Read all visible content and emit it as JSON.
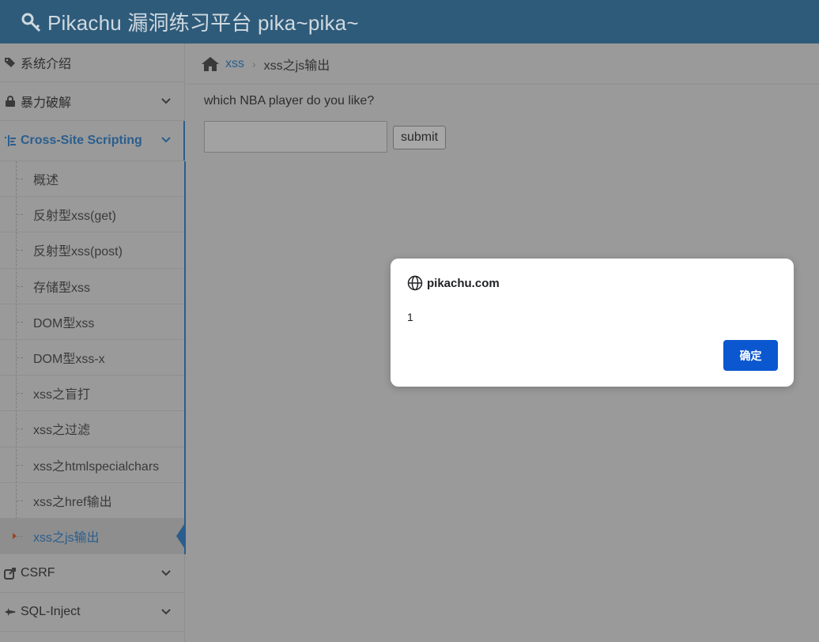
{
  "header": {
    "brand": "Pikachu 漏洞练习平台 pika~pika~"
  },
  "sidebar": {
    "top_items": [
      {
        "label": "系统介绍"
      },
      {
        "label": "暴力破解"
      },
      {
        "label": "Cross-Site Scripting"
      }
    ],
    "xss_submenu": [
      "概述",
      "反射型xss(get)",
      "反射型xss(post)",
      "存储型xss",
      "DOM型xss",
      "DOM型xss-x",
      "xss之盲打",
      "xss之过滤",
      "xss之htmlspecialchars",
      "xss之href输出",
      "xss之js输出"
    ],
    "bottom_items": [
      {
        "label": "CSRF"
      },
      {
        "label": "SQL-Inject"
      }
    ]
  },
  "breadcrumb": {
    "link": "xss",
    "current": "xss之js输出"
  },
  "form": {
    "question": "which NBA player do you like?",
    "input_value": "",
    "submit_label": "submit"
  },
  "dialog": {
    "origin": "pikachu.com",
    "message": "1",
    "ok_label": "确定"
  },
  "colors": {
    "header_bg": "#2f5b7a",
    "accent": "#2a5e8c",
    "dialog_button": "#0b57d0"
  }
}
